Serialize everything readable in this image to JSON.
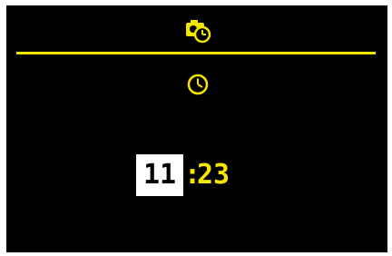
{
  "header": {
    "icon": "camera-clock-icon"
  },
  "content": {
    "icon": "clock-icon",
    "time": {
      "hours": "11",
      "separator": ":",
      "minutes": "23",
      "selected_field": "hours"
    }
  },
  "colors": {
    "background": "#000000",
    "accent": "#f5e600",
    "highlight_bg": "#ffffff",
    "highlight_fg": "#000000"
  }
}
